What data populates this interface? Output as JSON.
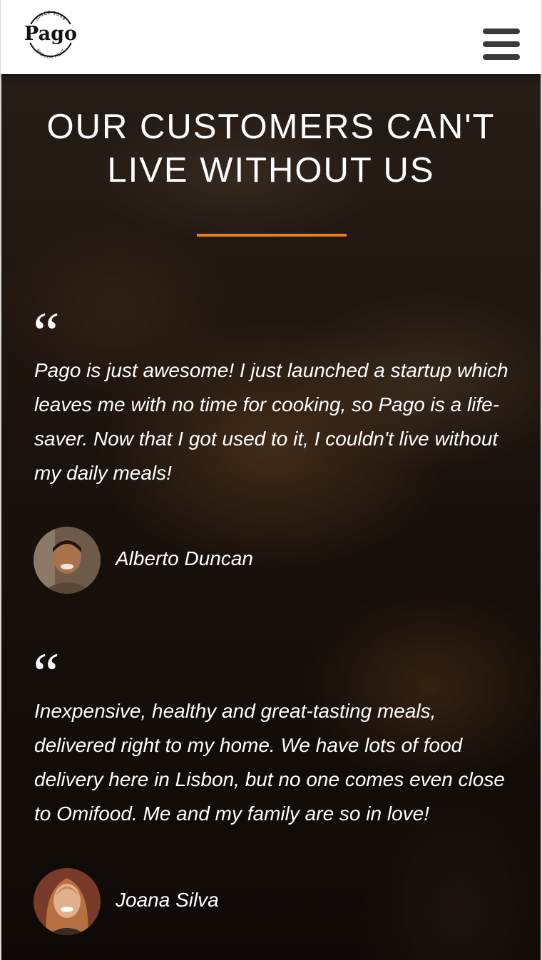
{
  "header": {
    "logo": {
      "brand": "Pago",
      "top_text": "SINCE 1888",
      "bottom_text": "PREMIUM FRUIT"
    },
    "menu_icon": "hamburger-menu-icon"
  },
  "testimonials": {
    "title": "OUR CUSTOMERS CAN'T LIVE WITHOUT US",
    "accent_color": "#e67e22",
    "items": [
      {
        "quote_mark": "“",
        "text": "Pago is just awesome! I just launched a startup which leaves me with no time for cooking, so Pago is a life-saver. Now that I got used to it, I couldn't live without my daily meals!",
        "author": "Alberto Duncan",
        "avatar_icon": "customer-photo-alberto"
      },
      {
        "quote_mark": "“",
        "text": "Inexpensive, healthy and great-tasting meals, delivered right to my home. We have lots of food delivery here in Lisbon, but no one comes even close to Omifood. Me and my family are so in love!",
        "author": "Joana Silva",
        "avatar_icon": "customer-photo-joana"
      }
    ]
  }
}
